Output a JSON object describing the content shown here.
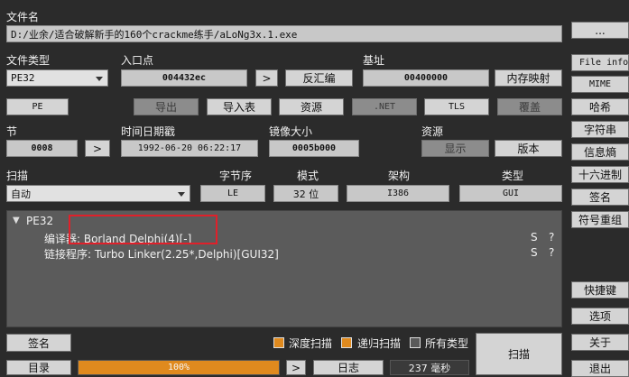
{
  "labels": {
    "filename": "文件名",
    "filetype": "文件类型",
    "entry": "入口点",
    "base": "基址",
    "section": "节",
    "datetime": "时间日期戳",
    "imagesize": "镜像大小",
    "resource": "资源",
    "scan": "扫描",
    "endian": "字节序",
    "mode": "模式",
    "arch": "架构",
    "type": "类型"
  },
  "fields": {
    "filepath": "D:/业余/适合破解新手的160个crackme练手/aLoNg3x.1.exe",
    "entry": "004432ec",
    "base": "00400000",
    "section": "0008",
    "datetime": "1992-06-20 06:22:17",
    "imagesize": "0005b000",
    "endian": "LE",
    "mode": "32 位",
    "arch": "I386",
    "type": "GUI"
  },
  "combos": {
    "filetype": "PE32",
    "scanmode": "自动"
  },
  "buttons": {
    "browse": "...",
    "arrow_entry": ">",
    "disasm": "反汇编",
    "memmap": "内存映射",
    "pe": "PE",
    "export": "导出",
    "import": "导入表",
    "resources": "资源",
    "net": ".NET",
    "tls": "TLS",
    "overlay": "覆盖",
    "arrow_section": ">",
    "show": "显示",
    "version": "版本",
    "signature": "签名",
    "directory": "目录",
    "arrow_bottom": ">",
    "log": "日志",
    "scan": "扫描"
  },
  "sidebar": [
    "File info",
    "MIME",
    "哈希",
    "字符串",
    "信息熵",
    "十六进制",
    "签名",
    "符号重组"
  ],
  "sidebar_bottom": [
    "快捷键",
    "选项",
    "关于",
    "退出"
  ],
  "results": {
    "root": "PE32",
    "rows": [
      {
        "text": "编译器: Borland Delphi(4)[-]",
        "s": "S",
        "q": "?"
      },
      {
        "text": "链接程序: Turbo Linker(2.25*,Delphi)[GUI32]",
        "s": "S",
        "q": "?"
      }
    ]
  },
  "options": {
    "deep": "深度扫描",
    "recursive": "递归扫描",
    "alltypes": "所有类型"
  },
  "progress": {
    "text": "100%",
    "value": 1.0
  },
  "timing": "237 毫秒",
  "colors": {
    "accent": "#e08a1e",
    "highlight": "#e0202a"
  }
}
